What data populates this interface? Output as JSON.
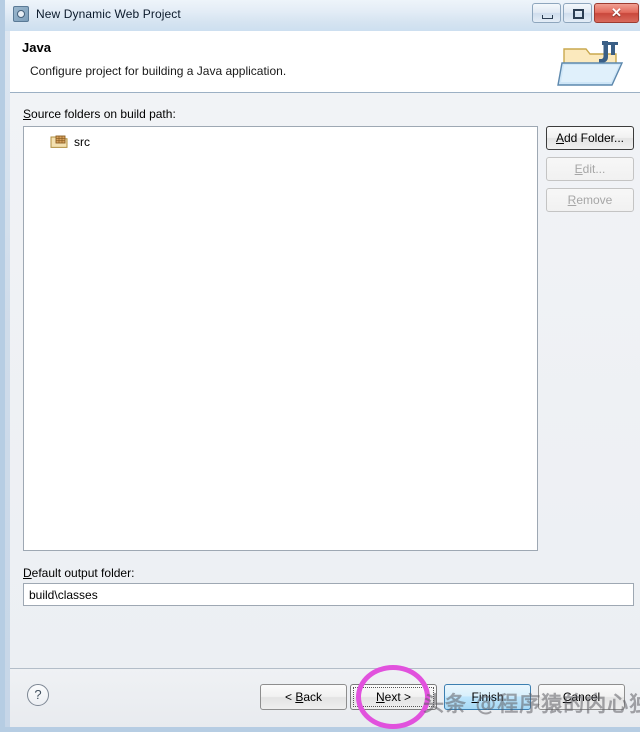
{
  "window": {
    "title": "New Dynamic Web Project",
    "icon": "eclipse-wizard-icon",
    "buttons": {
      "minimize": "minimize-button",
      "maximize": "maximize-button",
      "close": "✕"
    }
  },
  "header": {
    "title": "Java",
    "description": "Configure project for building a Java application.",
    "banner_icon": "java-folder-banner-icon"
  },
  "main": {
    "source_folders_label_accel": "S",
    "source_folders_label_rest": "ource folders on build path:",
    "tree_items": [
      {
        "label": "src",
        "icon": "source-folder-icon"
      }
    ],
    "side_buttons": [
      {
        "name": "add-folder-button",
        "accel": "A",
        "rest": "dd Folder...",
        "enabled": true,
        "focused": true
      },
      {
        "name": "edit-button",
        "accel": "E",
        "rest": "dit...",
        "enabled": false,
        "focused": false
      },
      {
        "name": "remove-button",
        "accel": "R",
        "rest": "emove",
        "enabled": false,
        "focused": false
      }
    ],
    "output_label_accel": "D",
    "output_label_rest": "efault output folder:",
    "output_value": "build\\classes",
    "output_placeholder": "Default output folder"
  },
  "footer": {
    "help_glyph": "?",
    "back": {
      "pre": "< ",
      "accel": "B",
      "rest": "ack"
    },
    "next": {
      "pre": "",
      "accel": "N",
      "rest": "ext >"
    },
    "finish": {
      "pre": "",
      "accel": "F",
      "rest": "inish"
    },
    "cancel": {
      "pre": "",
      "accel": "C",
      "rest": "ancel"
    }
  },
  "annotations": {
    "highlight_target": "next-button",
    "highlight_color": "#e152dd",
    "watermark": "头条 @程序猿的内心独白"
  }
}
